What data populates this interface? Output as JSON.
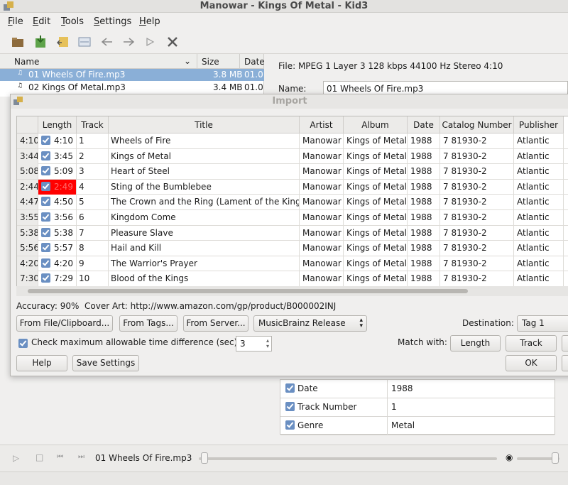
{
  "window": {
    "title": "Manowar - Kings Of Metal - Kid3"
  },
  "menu": [
    "File",
    "Edit",
    "Tools",
    "Settings",
    "Help"
  ],
  "toolbar": {
    "icons": [
      "open-folder-icon",
      "save-icon",
      "revert-icon",
      "import-icon",
      "back-icon",
      "forward-icon",
      "play-icon",
      "settings-icon"
    ]
  },
  "file_list": {
    "columns": [
      "Name",
      "Size",
      "Date"
    ],
    "rows": [
      {
        "name": "01 Wheels Of Fire.mp3",
        "size": "3.8 MB",
        "date": "01.0",
        "selected": true
      },
      {
        "name": "02 Kings Of Metal.mp3",
        "size": "3.4 MB",
        "date": "01.0",
        "selected": false
      }
    ]
  },
  "file_info": {
    "label": "File: MPEG 1 Layer 3 128 kbps 44100 Hz Stereo 4:10",
    "name_label": "Name:",
    "name_value": "01 Wheels Of Fire.mp3"
  },
  "tag_fields": [
    {
      "name": "Date",
      "value": "1988"
    },
    {
      "name": "Track Number",
      "value": "1"
    },
    {
      "name": "Genre",
      "value": "Metal"
    }
  ],
  "player": {
    "current_file": "01 Wheels Of Fire.mp3"
  },
  "dialog": {
    "title": "Import",
    "columns": [
      "Length",
      "Track",
      "Title",
      "Artist",
      "Album",
      "Date",
      "Catalog Number",
      "Publisher"
    ],
    "tracks": [
      {
        "file_length": "4:10",
        "length": "4:10",
        "track": "1",
        "title": "Wheels of Fire",
        "artist": "Manowar",
        "album": "Kings of Metal",
        "date": "1988",
        "catalog": "7 81930-2",
        "publisher": "Atlantic",
        "mismatch": false
      },
      {
        "file_length": "3:44",
        "length": "3:45",
        "track": "2",
        "title": "Kings of Metal",
        "artist": "Manowar",
        "album": "Kings of Metal",
        "date": "1988",
        "catalog": "7 81930-2",
        "publisher": "Atlantic",
        "mismatch": false
      },
      {
        "file_length": "5:08",
        "length": "5:09",
        "track": "3",
        "title": "Heart of Steel",
        "artist": "Manowar",
        "album": "Kings of Metal",
        "date": "1988",
        "catalog": "7 81930-2",
        "publisher": "Atlantic",
        "mismatch": false
      },
      {
        "file_length": "2:44",
        "length": "2:49",
        "track": "4",
        "title": "Sting of the Bumblebee",
        "artist": "Manowar",
        "album": "Kings of Metal",
        "date": "1988",
        "catalog": "7 81930-2",
        "publisher": "Atlantic",
        "mismatch": true
      },
      {
        "file_length": "4:47",
        "length": "4:50",
        "track": "5",
        "title": "The Crown and the Ring (Lament of the Kings)",
        "artist": "Manowar",
        "album": "Kings of Metal",
        "date": "1988",
        "catalog": "7 81930-2",
        "publisher": "Atlantic",
        "mismatch": false
      },
      {
        "file_length": "3:55",
        "length": "3:56",
        "track": "6",
        "title": "Kingdom Come",
        "artist": "Manowar",
        "album": "Kings of Metal",
        "date": "1988",
        "catalog": "7 81930-2",
        "publisher": "Atlantic",
        "mismatch": false
      },
      {
        "file_length": "5:38",
        "length": "5:38",
        "track": "7",
        "title": "Pleasure Slave",
        "artist": "Manowar",
        "album": "Kings of Metal",
        "date": "1988",
        "catalog": "7 81930-2",
        "publisher": "Atlantic",
        "mismatch": false
      },
      {
        "file_length": "5:56",
        "length": "5:57",
        "track": "8",
        "title": "Hail and Kill",
        "artist": "Manowar",
        "album": "Kings of Metal",
        "date": "1988",
        "catalog": "7 81930-2",
        "publisher": "Atlantic",
        "mismatch": false
      },
      {
        "file_length": "4:20",
        "length": "4:20",
        "track": "9",
        "title": "The Warrior's Prayer",
        "artist": "Manowar",
        "album": "Kings of Metal",
        "date": "1988",
        "catalog": "7 81930-2",
        "publisher": "Atlantic",
        "mismatch": false
      },
      {
        "file_length": "7:30",
        "length": "7:29",
        "track": "10",
        "title": "Blood of the Kings",
        "artist": "Manowar",
        "album": "Kings of Metal",
        "date": "1988",
        "catalog": "7 81930-2",
        "publisher": "Atlantic",
        "mismatch": false
      }
    ],
    "accuracy": "Accuracy:  90%",
    "cover_art": "Cover Art:  http://www.amazon.com/gp/product/B000002INJ",
    "buttons": {
      "from_file": "From File/Clipboard...",
      "from_tags": "From Tags...",
      "from_server": "From Server...",
      "server_combo": "MusicBrainz Release",
      "destination_label": "Destination:",
      "destination_value": "Tag 1",
      "check_time_label": "Check maximum allowable time difference (sec):",
      "time_value": "3",
      "match_with_label": "Match with:",
      "match_length": "Length",
      "match_track": "Track",
      "help": "Help",
      "save_settings": "Save Settings",
      "ok": "OK"
    },
    "mismatch_color": "#ff0000"
  }
}
